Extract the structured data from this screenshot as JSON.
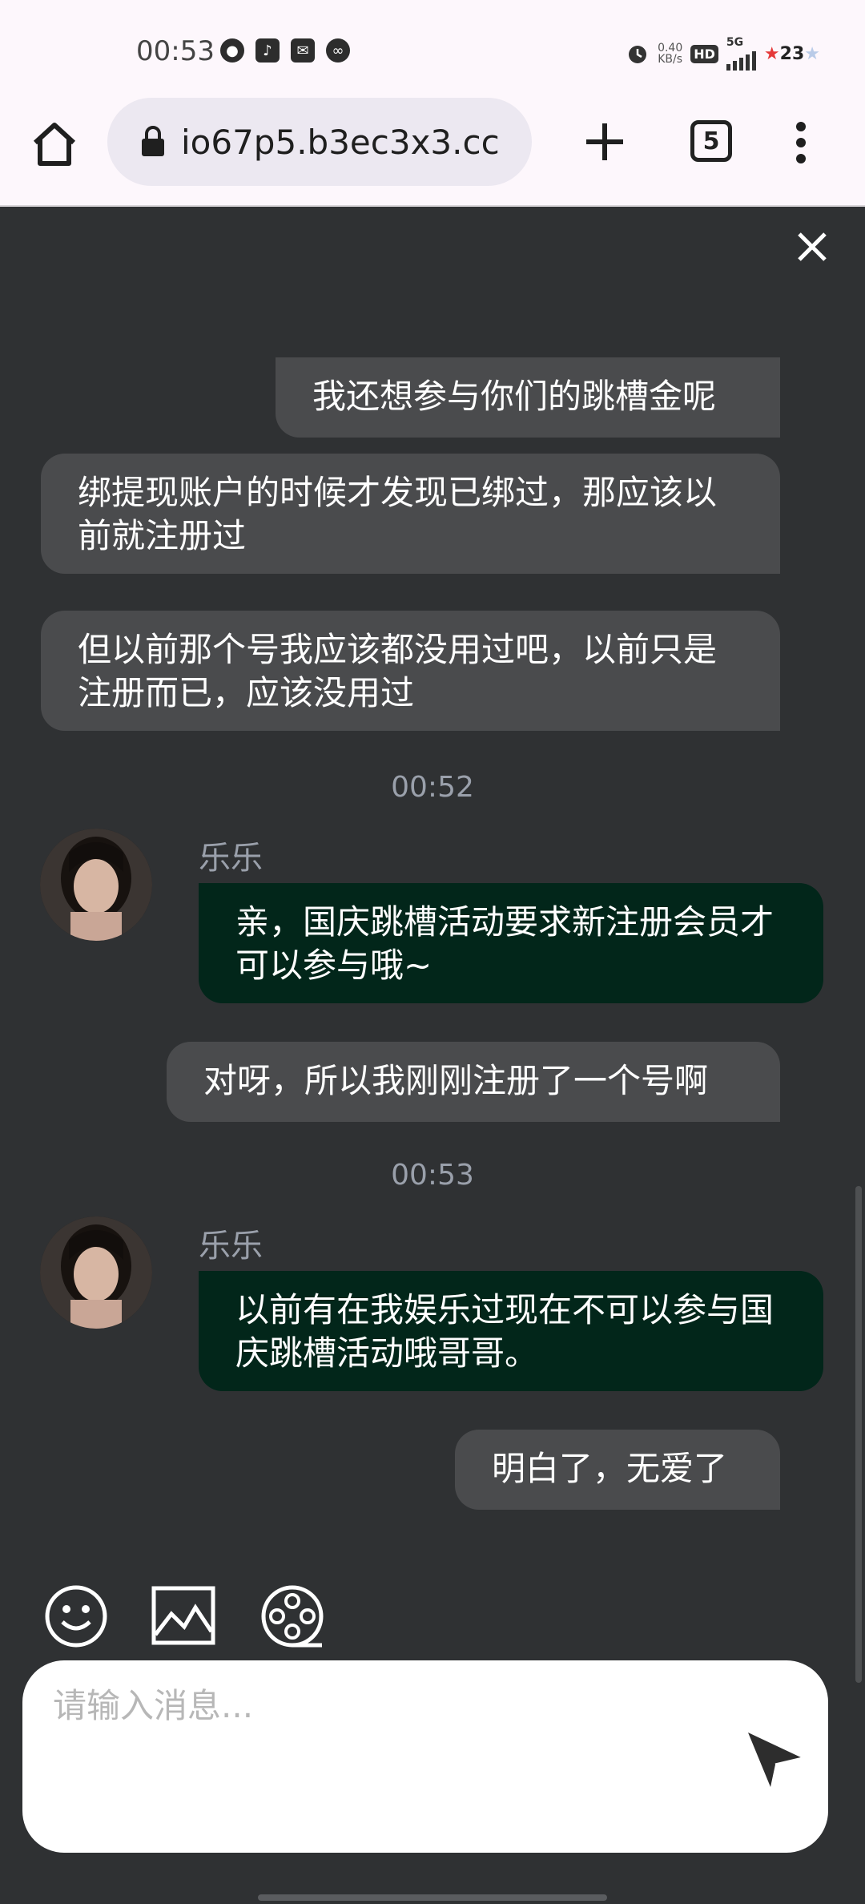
{
  "status_bar": {
    "time": "00:53",
    "net_speed_value": "0.40",
    "net_speed_unit": "KB/s",
    "hd_label": "HD",
    "network_label": "5G",
    "battery": "23"
  },
  "browser": {
    "url": "io67p5.b3ec3x3.cc",
    "tab_count": "5"
  },
  "chat": {
    "messages": [
      {
        "text": "我还想参与你们的跳槽金呢"
      },
      {
        "text": "绑提现账户的时候才发现已绑过，那应该以前就注册过"
      },
      {
        "text": "但以前那个号我应该都没用过吧，以前只是注册而已，应该没用过"
      },
      {
        "timestamp": "00:52"
      },
      {
        "sender": "乐乐",
        "text": "亲，国庆跳槽活动要求新注册会员才可以参与哦~"
      },
      {
        "text": "对呀，所以我刚刚注册了一个号啊"
      },
      {
        "timestamp": "00:53"
      },
      {
        "sender": "乐乐",
        "text": "以前有在我娱乐过现在不可以参与国庆跳槽活动哦哥哥。"
      },
      {
        "text": "明白了，无爱了"
      }
    ]
  },
  "composer": {
    "placeholder": "请输入消息..."
  },
  "colors": {
    "chat_bg": "#2f3133",
    "user_bubble": "#4a4b4d",
    "agent_bubble": "#02261a",
    "browser_bar": "#fdf7fc"
  }
}
